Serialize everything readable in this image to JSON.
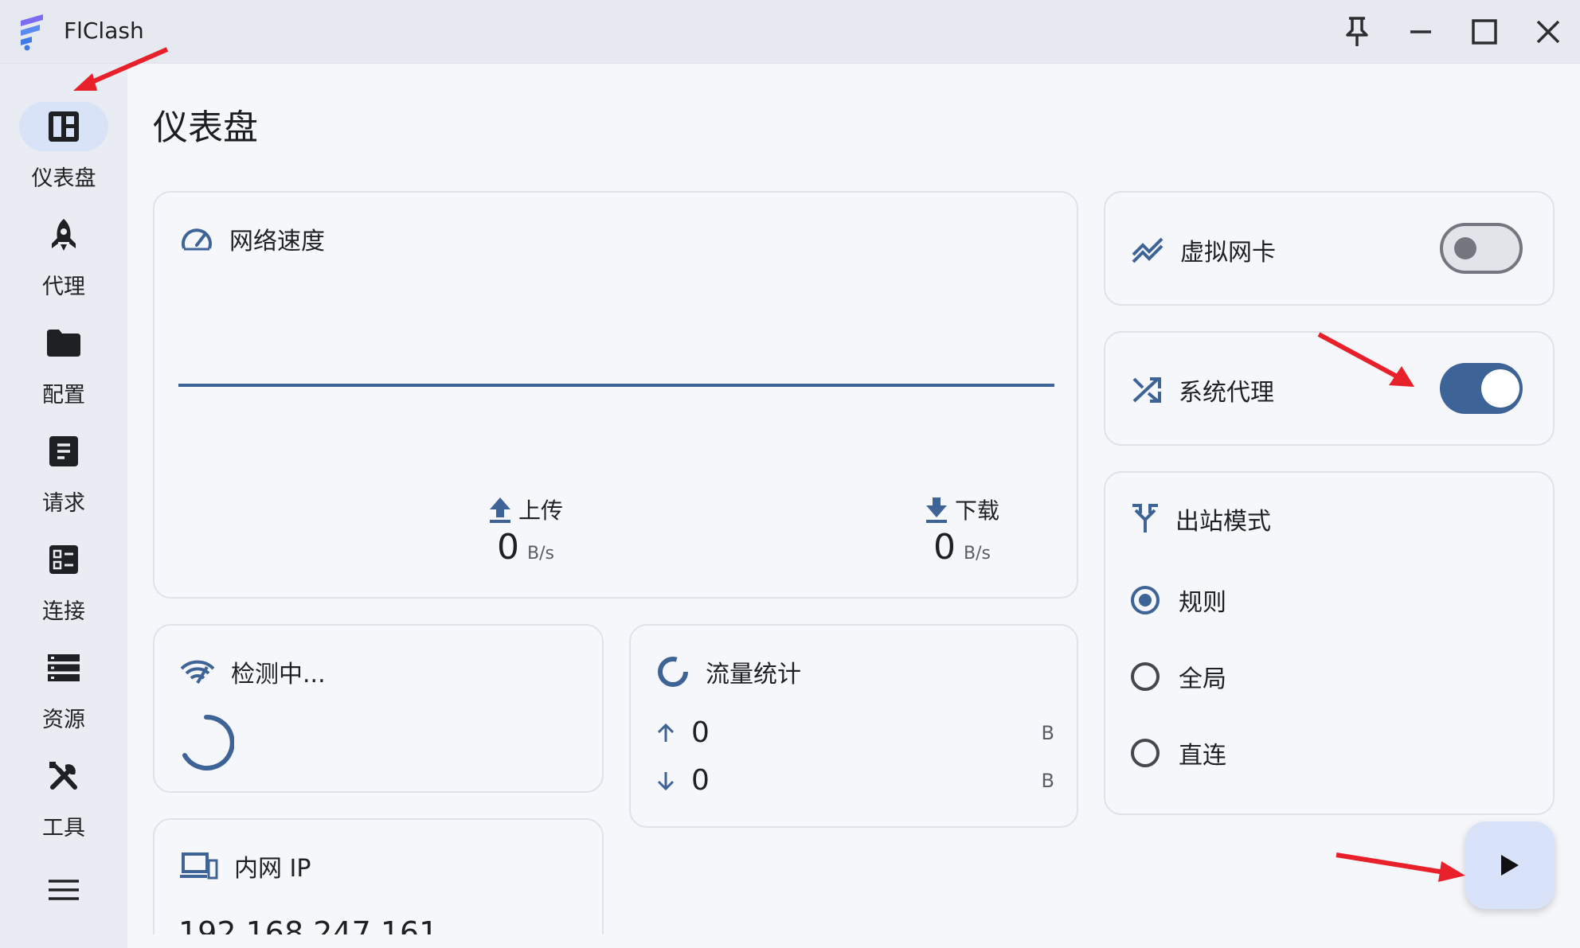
{
  "window": {
    "title": "FlClash",
    "controls": [
      "pin-icon",
      "minimize-icon",
      "maximize-icon",
      "close-icon"
    ]
  },
  "sidebar": {
    "items": [
      {
        "label": "仪表盘",
        "icon": "dashboard-icon",
        "active": true
      },
      {
        "label": "代理",
        "icon": "rocket-icon",
        "active": false
      },
      {
        "label": "配置",
        "icon": "folder-icon",
        "active": false
      },
      {
        "label": "请求",
        "icon": "request-icon",
        "active": false
      },
      {
        "label": "连接",
        "icon": "connections-icon",
        "active": false
      },
      {
        "label": "资源",
        "icon": "storage-icon",
        "active": false
      },
      {
        "label": "工具",
        "icon": "tools-icon",
        "active": false
      }
    ],
    "menu_icon": "menu-icon"
  },
  "page": {
    "title": "仪表盘"
  },
  "network_speed": {
    "title": "网络速度",
    "upload": {
      "label": "上传",
      "value": "0",
      "unit": "B/s"
    },
    "download": {
      "label": "下载",
      "value": "0",
      "unit": "B/s"
    }
  },
  "tun": {
    "label": "虚拟网卡",
    "enabled": false
  },
  "system_proxy": {
    "label": "系统代理",
    "enabled": true
  },
  "outbound_mode": {
    "title": "出站模式",
    "options": [
      {
        "label": "规则",
        "selected": true
      },
      {
        "label": "全局",
        "selected": false
      },
      {
        "label": "直连",
        "selected": false
      }
    ]
  },
  "network_detection": {
    "title": "检测中..."
  },
  "traffic": {
    "title": "流量统计",
    "up": {
      "value": "0",
      "unit": "B"
    },
    "down": {
      "value": "0",
      "unit": "B"
    }
  },
  "intranet_ip": {
    "title": "内网 IP",
    "value": "192.168.247.161"
  },
  "colors": {
    "accent": "#3e6397",
    "annotation": "#e8202a",
    "fab_bg": "#d8e2f9"
  }
}
